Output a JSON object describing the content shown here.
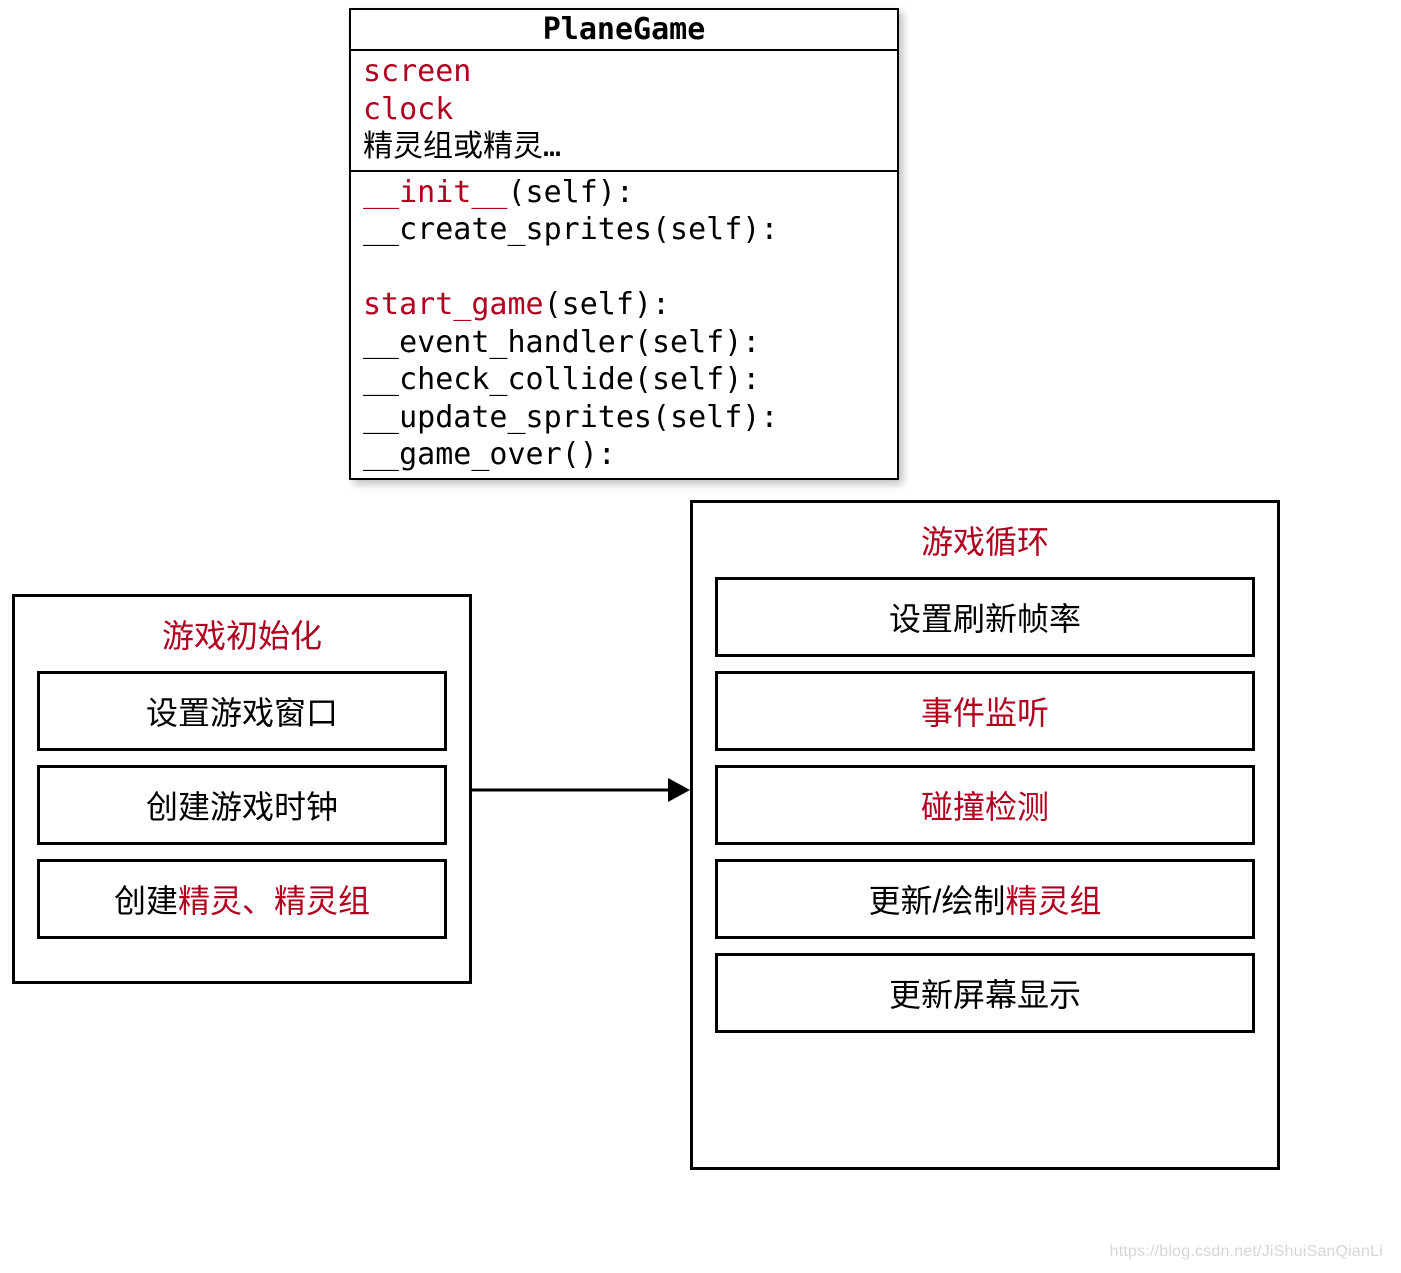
{
  "colors": {
    "accent": "#b00020",
    "border": "#000000"
  },
  "class_box": {
    "title": "PlaneGame",
    "attrs": [
      [
        {
          "text": "screen",
          "cls": "red"
        }
      ],
      [
        {
          "text": "clock",
          "cls": "red"
        }
      ],
      [
        {
          "text": "精灵组或精灵…",
          "cls": "black"
        }
      ]
    ],
    "methods": [
      [
        {
          "text": "__init__",
          "cls": "red"
        },
        {
          "text": "(self):",
          "cls": "black"
        }
      ],
      [
        {
          "text": "__create_sprites(self):",
          "cls": "black"
        }
      ],
      [
        {
          "text": " ",
          "cls": "black"
        }
      ],
      [
        {
          "text": "start_game",
          "cls": "red"
        },
        {
          "text": "(self):",
          "cls": "black"
        }
      ],
      [
        {
          "text": "__event_handler(self):",
          "cls": "black"
        }
      ],
      [
        {
          "text": "__check_collide(self):",
          "cls": "black"
        }
      ],
      [
        {
          "text": "__update_sprites(self):",
          "cls": "black"
        }
      ],
      [
        {
          "text": "__game_over():",
          "cls": "black"
        }
      ]
    ]
  },
  "init_box": {
    "title": "游戏初始化",
    "steps": [
      [
        {
          "text": "设置游戏窗口",
          "cls": "black"
        }
      ],
      [
        {
          "text": "创建游戏时钟",
          "cls": "black"
        }
      ],
      [
        {
          "text": "创建",
          "cls": "black"
        },
        {
          "text": "精灵、精灵组",
          "cls": "red"
        }
      ]
    ]
  },
  "loop_box": {
    "title": "游戏循环",
    "steps": [
      [
        {
          "text": "设置刷新帧率",
          "cls": "black"
        }
      ],
      [
        {
          "text": "事件监听",
          "cls": "red"
        }
      ],
      [
        {
          "text": "碰撞检测",
          "cls": "red"
        }
      ],
      [
        {
          "text": "更新/绘制",
          "cls": "black"
        },
        {
          "text": "精灵组",
          "cls": "red"
        }
      ],
      [
        {
          "text": "更新屏幕显示",
          "cls": "black"
        }
      ]
    ]
  },
  "watermark": "https://blog.csdn.net/JiShuiSanQianLi"
}
